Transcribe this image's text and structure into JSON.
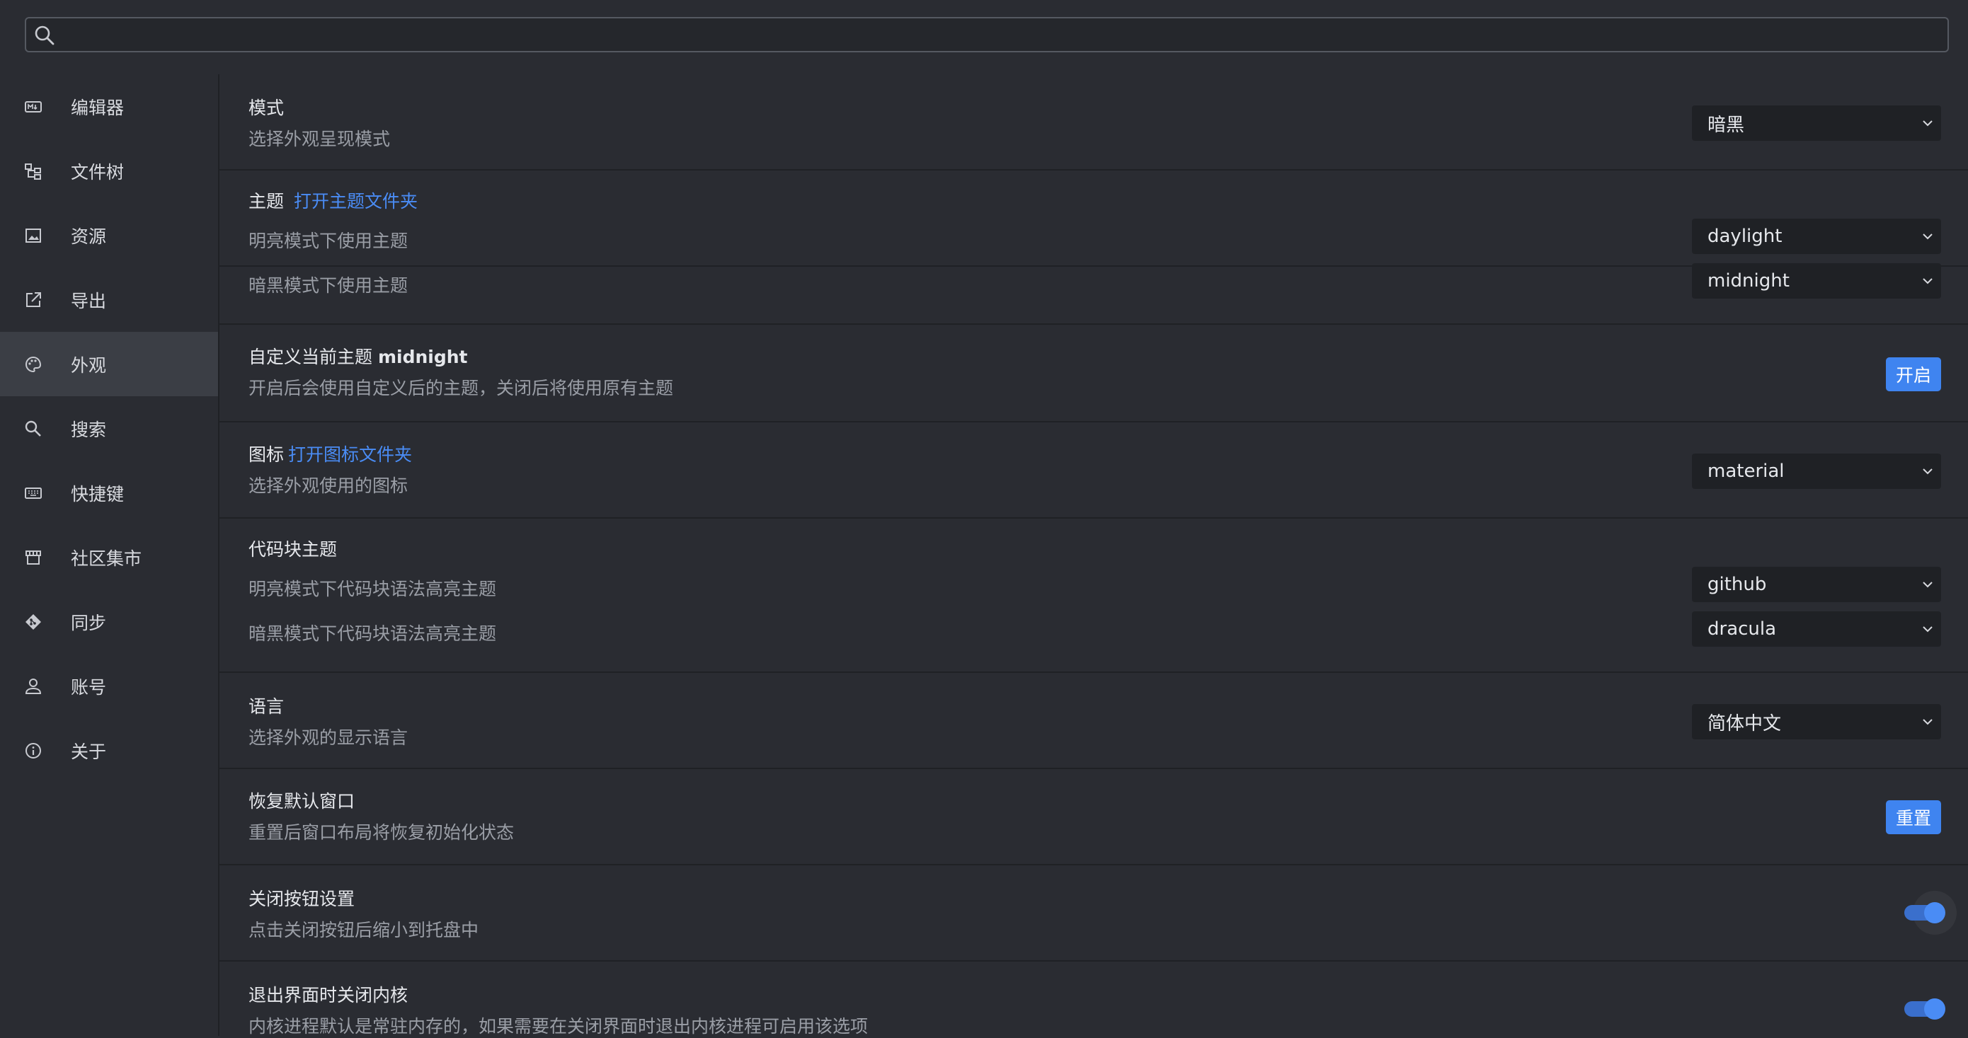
{
  "search": {
    "placeholder": "",
    "value": ""
  },
  "sidebar": {
    "items": [
      {
        "label": "编辑器",
        "icon": "markdown-icon"
      },
      {
        "label": "文件树",
        "icon": "file-tree-icon"
      },
      {
        "label": "资源",
        "icon": "image-icon"
      },
      {
        "label": "导出",
        "icon": "export-icon"
      },
      {
        "label": "外观",
        "icon": "palette-icon",
        "active": true
      },
      {
        "label": "搜索",
        "icon": "search-icon"
      },
      {
        "label": "快捷键",
        "icon": "keyboard-icon"
      },
      {
        "label": "社区集市",
        "icon": "store-icon"
      },
      {
        "label": "同步",
        "icon": "sync-icon"
      },
      {
        "label": "账号",
        "icon": "account-icon"
      },
      {
        "label": "关于",
        "icon": "info-icon"
      }
    ]
  },
  "main": {
    "mode": {
      "title": "模式",
      "desc": "选择外观呈现模式",
      "value": "暗黑"
    },
    "theme": {
      "title": "主题",
      "link": "打开主题文件夹",
      "light_label": "明亮模式下使用主题",
      "light_value": "daylight",
      "dark_label": "暗黑模式下使用主题",
      "dark_value": "midnight"
    },
    "customize": {
      "title": "自定义当前主题",
      "title_bold": "midnight",
      "desc": "开启后会使用自定义后的主题，关闭后将使用原有主题",
      "button": "开启"
    },
    "icon": {
      "title": "图标",
      "link": "打开图标文件夹",
      "desc": "选择外观使用的图标",
      "value": "material"
    },
    "code_theme": {
      "title": "代码块主题",
      "light_label": "明亮模式下代码块语法高亮主题",
      "light_value": "github",
      "dark_label": "暗黑模式下代码块语法高亮主题",
      "dark_value": "dracula"
    },
    "language": {
      "title": "语言",
      "desc": "选择外观的显示语言",
      "value": "简体中文"
    },
    "reset_window": {
      "title": "恢复默认窗口",
      "desc": "重置后窗口布局将恢复初始化状态",
      "button": "重置"
    },
    "close_button": {
      "title": "关闭按钮设置",
      "desc": "点击关闭按钮后缩小到托盘中",
      "enabled": true
    },
    "exit_kernel": {
      "title": "退出界面时关闭内核",
      "desc": "内核进程默认是常驻内存的，如果需要在关闭界面时退出内核进程可启用该选项",
      "enabled": true
    }
  },
  "colors": {
    "accent": "#3f84f0",
    "link": "#4a8cf5",
    "background": "#2a2c32",
    "active_nav": "#3b3e45"
  }
}
